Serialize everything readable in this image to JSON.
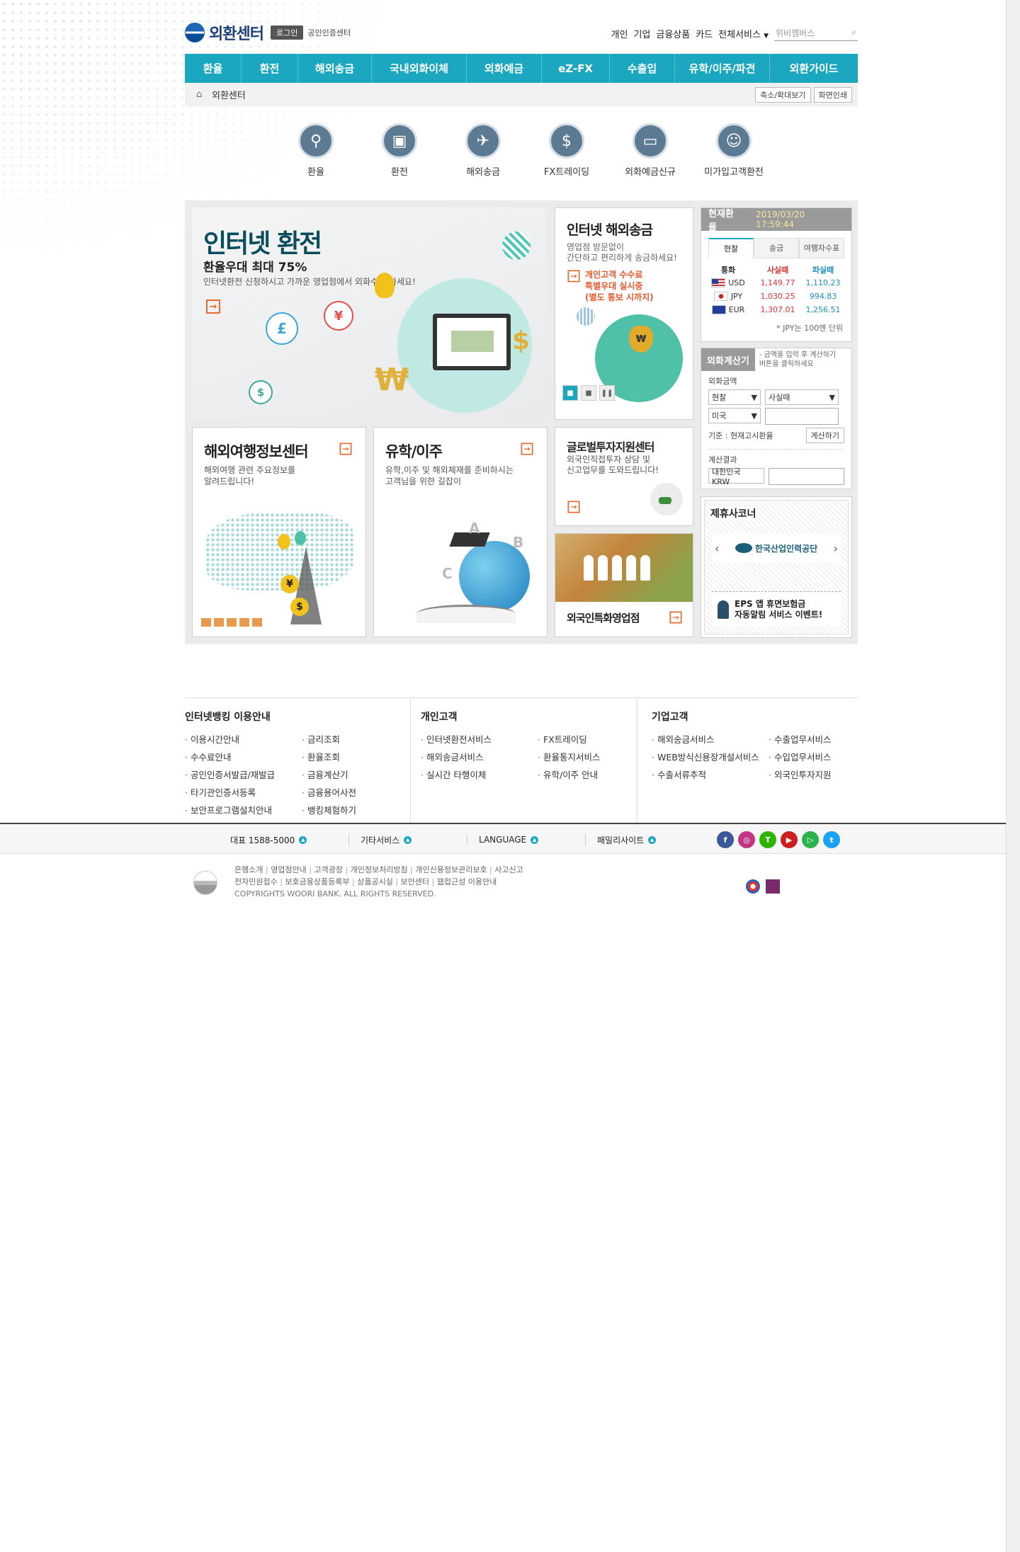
{
  "header": {
    "logo": "외환센터",
    "login": "로그인",
    "cert_center": "공인인증센터",
    "util_links": [
      "개인",
      "기업",
      "금융상품",
      "카드",
      "전체서비스"
    ],
    "search_placeholder": "위비멤버스"
  },
  "nav": [
    "환율",
    "환전",
    "해외송금",
    "국내외화이체",
    "외화예금",
    "eZ-FX",
    "수출입",
    "유학/이주/파견",
    "외환가이드"
  ],
  "breadcrumb": {
    "home": "외환센터",
    "zoom_btn": "축소/확대보기",
    "print_btn": "화면인쇄"
  },
  "quick_icons": [
    {
      "label": "환율",
      "icon": "search-icon"
    },
    {
      "label": "환전",
      "icon": "exchange-icon"
    },
    {
      "label": "해외송금",
      "icon": "plane-icon"
    },
    {
      "label": "FX트레이딩",
      "icon": "fx-icon"
    },
    {
      "label": "외화예금신규",
      "icon": "card-icon"
    },
    {
      "label": "미가입고객환전",
      "icon": "person-icon"
    }
  ],
  "banner_main": {
    "title": "인터넷 환전",
    "subtitle": "환율우대 최대 75%",
    "desc": "인터넷환전 신청하시고 가까운 영업점에서 외화수령 하세요!"
  },
  "banner_remit": {
    "title": "인터넷 해외송금",
    "desc1": "영업점 방문없이",
    "desc2": "간단하고 편리하게 송금하세요!",
    "hl1": "개인고객 수수료",
    "hl2": "특별우대 실시중",
    "hl3": "(별도 통보 시까지)"
  },
  "rates": {
    "title": "현재환율",
    "timestamp": "2019/03/20 17:59:44",
    "tabs": [
      "현찰",
      "송금",
      "여행자수표"
    ],
    "headers": [
      "통화",
      "사실때",
      "파실때"
    ],
    "rows": [
      {
        "code": "USD",
        "buy": "1,149.77",
        "sell": "1,110.23"
      },
      {
        "code": "JPY",
        "buy": "1,030.25",
        "sell": "994.83"
      },
      {
        "code": "EUR",
        "buy": "1,307.01",
        "sell": "1,256.51"
      }
    ],
    "note": "* JPY는 100엔 단위"
  },
  "calc": {
    "title": "외화계산기",
    "hint1": "- 금액을 입력 후 계산하기",
    "hint2": "버튼을 클릭하세요",
    "amount_label": "외화금액",
    "type": "현찰",
    "action": "사실때",
    "country": "미국",
    "basis": "기준 : 현재고시환율",
    "calc_btn": "계산하기",
    "result_label": "계산결과",
    "result_currency": "대한민국 KRW"
  },
  "partner": {
    "title": "제휴사코너",
    "logo_name": "한국산업인력공단",
    "event1": "EPS 앱 휴면보험금",
    "event2": "자동알림 서비스 이벤트!"
  },
  "cards": {
    "travel_title": "해외여행정보센터",
    "travel_desc1": "해외여행 관련 주요정보를",
    "travel_desc2": "알려드립니다!",
    "study_title": "유학/이주",
    "study_desc1": "유학,이주 및 해외체재를 준비하시는",
    "study_desc2": "고객님을 위한 길잡이",
    "global_title": "글로벌투자지원센터",
    "global_desc1": "외국인직접투자 상담 및",
    "global_desc2": "신고업무를 도와드립니다!",
    "foreign_title": "외국인특화영업점"
  },
  "footer_cols": [
    {
      "title": "인터넷뱅킹 이용안내",
      "items": [
        "이용시간안내",
        "금리조회",
        "수수료안내",
        "환율조회",
        "공인인증서발급/재발급",
        "금융계산기",
        "타기관인증서등록",
        "금융용어사전",
        "보안프로그램설치안내",
        "뱅킹체험하기"
      ]
    },
    {
      "title": "개인고객",
      "items": [
        "인터넷환전서비스",
        "FX트레이딩",
        "해외송금서비스",
        "환율통지서비스",
        "실시간 타행이체",
        "유학/이주 안내"
      ]
    },
    {
      "title": "기업고객",
      "items": [
        "해외송금서비스",
        "수출업무서비스",
        "WEB방식신용장개설서비스",
        "수입업무서비스",
        "수출서류추적",
        "외국인투자지원"
      ]
    }
  ],
  "bottom_bar": {
    "phone": "대표 1588-5000",
    "etc": "기타서비스",
    "lang": "LANGUAGE",
    "family": "패밀리사이트"
  },
  "sns": [
    {
      "name": "facebook-icon",
      "glyph": "f",
      "color": "#3b5998"
    },
    {
      "name": "instagram-icon",
      "glyph": "◎",
      "color": "#c13584"
    },
    {
      "name": "talk-icon",
      "glyph": "T",
      "color": "#2db400"
    },
    {
      "name": "youtube-icon",
      "glyph": "▶",
      "color": "#cc1e1e"
    },
    {
      "name": "play-icon",
      "glyph": "▷",
      "color": "#2bb24c"
    },
    {
      "name": "twitter-icon",
      "glyph": "t",
      "color": "#1da1f2"
    }
  ],
  "footer": {
    "links1": [
      "은행소개",
      "영업점안내",
      "고객광장",
      "개인정보처리방침",
      "개인신용정보관리보호",
      "사고신고"
    ],
    "links2": [
      "전자민원접수",
      "보호금융상품등록부",
      "상품공시실",
      "보안센터",
      "웹접근성 이용안내"
    ],
    "copyright": "COPYRIGHTS WOORI BANK. ALL RIGHTS RESERVED."
  }
}
